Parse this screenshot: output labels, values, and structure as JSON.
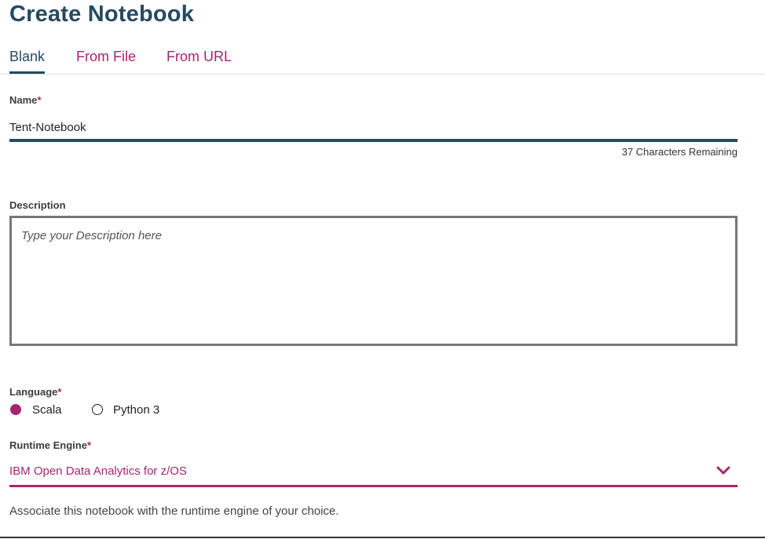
{
  "page": {
    "title": "Create Notebook"
  },
  "tabs": [
    {
      "label": "Blank",
      "active": true
    },
    {
      "label": "From File",
      "active": false
    },
    {
      "label": "From URL",
      "active": false
    }
  ],
  "form": {
    "name": {
      "label": "Name",
      "required_mark": "*",
      "value": "Tent-Notebook",
      "chars_remaining": "37 Characters Remaining"
    },
    "description": {
      "label": "Description",
      "placeholder": "Type your Description here",
      "value": ""
    },
    "language": {
      "label": "Language",
      "required_mark": "*",
      "options": [
        {
          "label": "Scala",
          "selected": true
        },
        {
          "label": "Python 3",
          "selected": false
        }
      ]
    },
    "runtime": {
      "label": "Runtime Engine",
      "required_mark": "*",
      "selected": "IBM Open Data Analytics for z/OS",
      "icon": "chevron-down-icon",
      "helper": "Associate this notebook with the runtime engine of your choice."
    }
  },
  "colors": {
    "primary": "#264a60",
    "accent": "#a6266e",
    "border": "#777777"
  }
}
